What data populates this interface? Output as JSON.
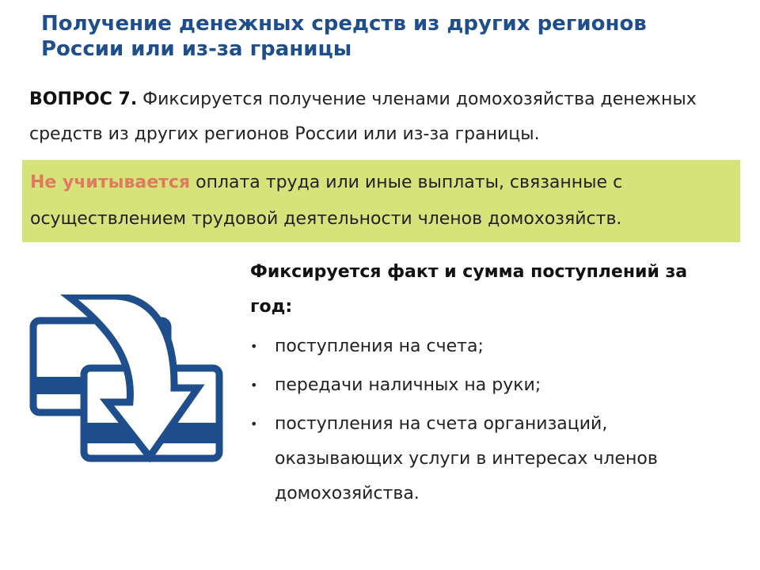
{
  "slide": {
    "title_line1": "Получение денежных средств из других регионов",
    "title_line2": "России или из-за границы"
  },
  "question": {
    "label": "ВОПРОС 7.",
    "text": " Фиксируется получение членами домохозяйства денежных средств из других регионов России или из-за границы."
  },
  "note": {
    "accent": "Не учитывается",
    "text": " оплата труда или иные выплаты, связанные с осуществлением трудовой деятельности членов домохозяйств."
  },
  "facts": {
    "heading": "Фиксируется факт и сумма поступлений за год:",
    "items": [
      {
        "text": "поступления на счета;"
      },
      {
        "text": "передачи наличных на руки;"
      },
      {
        "text": "поступления на счета организаций, оказывающих услуги в интересах членов домохозяйства."
      }
    ]
  },
  "icon": {
    "name": "transfer-cards-icon",
    "color": "#1f4e8c"
  },
  "colors": {
    "title": "#1f4e8c",
    "note_background": "#d6e27a",
    "note_accent": "#e07a5f"
  }
}
